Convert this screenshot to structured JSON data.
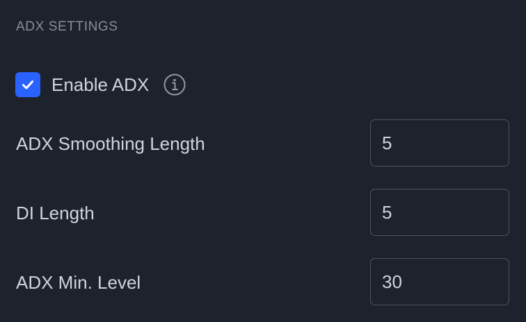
{
  "section": {
    "title": "ADX SETTINGS"
  },
  "enable_adx": {
    "label": "Enable ADX",
    "checked": true,
    "checkbox_color": "#2962ff",
    "info_icon": "info-icon"
  },
  "fields": [
    {
      "label": "ADX Smoothing Length",
      "value": "5"
    },
    {
      "label": "DI Length",
      "value": "5"
    },
    {
      "label": "ADX Min. Level",
      "value": "30"
    }
  ],
  "colors": {
    "background": "#1e222d",
    "text": "#d1d4dc",
    "muted_text": "#8a8e99",
    "input_border": "#50535e",
    "accent": "#2962ff"
  }
}
